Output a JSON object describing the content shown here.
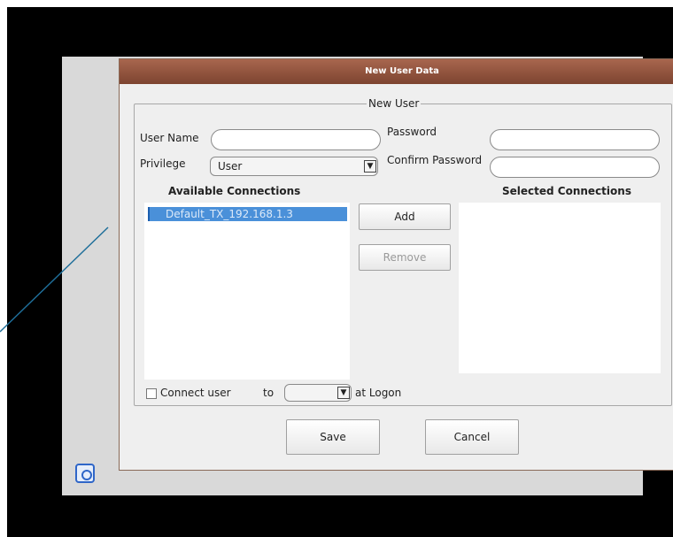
{
  "dialog": {
    "title": "New User Data",
    "group_label": "New User",
    "user_name_label": "User Name",
    "user_name_value": "",
    "password_label": "Password",
    "password_value": "",
    "privilege_label": "Privilege",
    "privilege_value": "User",
    "confirm_password_label": "Confirm Password",
    "confirm_password_value": "",
    "available_header": "Available Connections",
    "selected_header": "Selected Connections",
    "available_items": [
      "Default_TX_192.168.1.3"
    ],
    "selected_items": [],
    "add_label": "Add",
    "remove_label": "Remove",
    "connect_user_label": "Connect user",
    "to_label": "to",
    "connect_target_value": "",
    "at_logon_label": "at Logon",
    "save_label": "Save",
    "cancel_label": "Cancel"
  },
  "colors": {
    "title_bar": "#8e5440",
    "selection": "#4a90d9",
    "callout_line": "#1f6f9a"
  },
  "icons": {
    "taskbar": "power-icon",
    "dropdown": "chevron-down-icon"
  }
}
